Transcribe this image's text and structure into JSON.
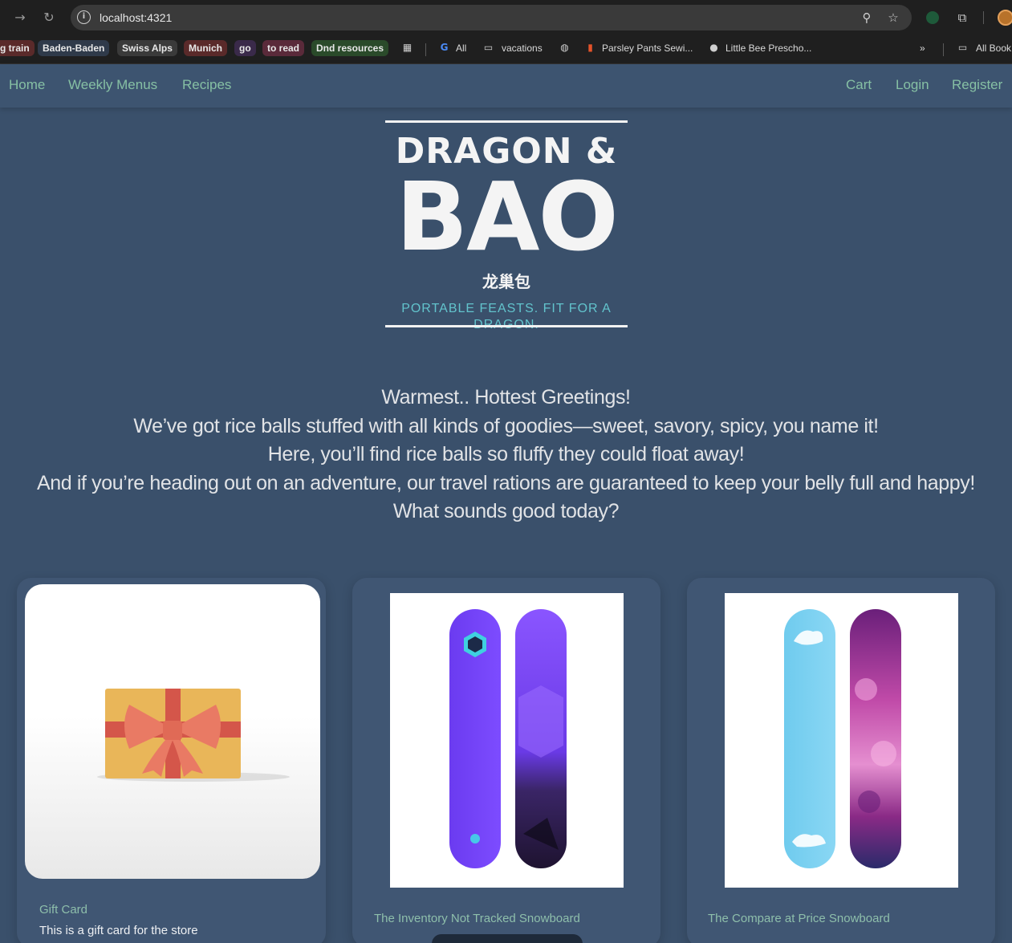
{
  "browser": {
    "url": "localhost:4321",
    "bookmarks_chips": [
      {
        "label": "g train",
        "color": "#5a2a2a"
      },
      {
        "label": "Baden-Baden",
        "color": "#2f3a4a"
      },
      {
        "label": "Swiss Alps",
        "color": "#3a3a3a"
      },
      {
        "label": "Munich",
        "color": "#5a2a2a"
      },
      {
        "label": "go",
        "color": "#3a2a4a"
      },
      {
        "label": "to read",
        "color": "#5a2a3a"
      },
      {
        "label": "Dnd resources",
        "color": "#2a4a2a"
      }
    ],
    "bookmarks": {
      "all": "All",
      "vacations": "vacations",
      "parsley": "Parsley Pants Sewi...",
      "littlebee": "Little Bee Prescho...",
      "overflow": "»",
      "all_bookmarks": "All Book"
    }
  },
  "nav": {
    "home": "Home",
    "weekly_menus": "Weekly Menus",
    "recipes": "Recipes",
    "cart": "Cart",
    "login": "Login",
    "register": "Register"
  },
  "logo": {
    "line1": "DRAGON &",
    "line2": "BAO",
    "chinese": "龙巢包",
    "tagline": "PORTABLE FEASTS.  FIT FOR A DRAGON."
  },
  "greeting": {
    "line1": "Warmest.. Hottest Greetings!",
    "line2": "We’ve got rice balls stuffed with all kinds of goodies—sweet, savory, spicy, you name it!",
    "line3": "Here, you’ll find rice balls so fluffy they could float away!",
    "line4": "And if you’re heading out on an adventure, our travel rations are guaranteed to keep your belly full and happy! What sounds good today?"
  },
  "products": [
    {
      "title": "Gift Card",
      "description": "This is a gift card for the store"
    },
    {
      "title": "The Inventory Not Tracked Snowboard",
      "description": ""
    },
    {
      "title": "The Compare at Price Snowboard",
      "description": ""
    }
  ],
  "colors": {
    "page_bg": "#3a506b",
    "nav_link": "#86c0a4",
    "tagline": "#62c3cc"
  }
}
